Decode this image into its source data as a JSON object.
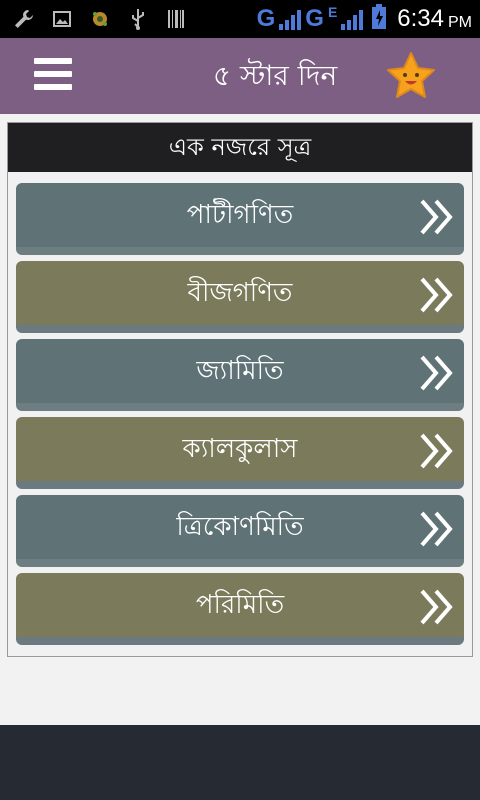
{
  "status_bar": {
    "network1": "G",
    "network2": "G",
    "network3": "E",
    "time": "6:34",
    "ampm": "PM",
    "icons": [
      "wrench-icon",
      "image-icon",
      "gear-icon",
      "usb-icon",
      "barcode-icon"
    ],
    "accent": "#4e7ad9"
  },
  "app_bar": {
    "title": "৫ স্টার দিন",
    "background": "#7c5f82"
  },
  "card": {
    "header": "এক নজরে সূত্র",
    "items": [
      {
        "label": "পাটীগণিত"
      },
      {
        "label": "বীজগণিত"
      },
      {
        "label": "জ্যামিতি"
      },
      {
        "label": "ক্যালকুলাস"
      },
      {
        "label": "ত্রিকোণমিতি"
      },
      {
        "label": "পরিমিতি"
      }
    ]
  }
}
